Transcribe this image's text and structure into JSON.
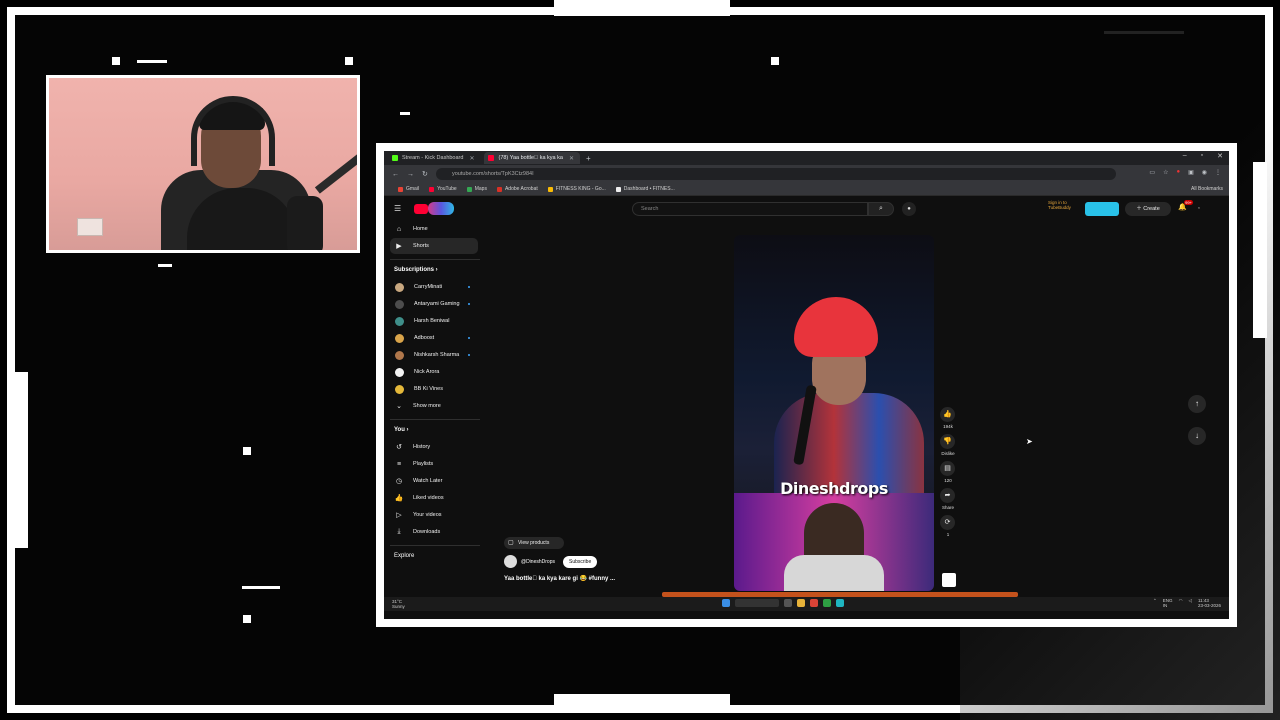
{
  "browser": {
    "tabs": [
      {
        "label": "Stream - Kick Dashboard",
        "favicon_color": "#53fc18",
        "active": false
      },
      {
        "label": "(78) Yaa bottle\u0000 ka kya ka",
        "favicon_color": "#ff0033",
        "active": true
      }
    ],
    "new_tab": "+",
    "url": "youtube.com/shorts/TpK3Ctz984I",
    "bookmarks": [
      "Gmail",
      "YouTube",
      "Maps",
      "Adobe Acrobat",
      "FITNESS KING - Go...",
      "Dashboard • FITNES..."
    ],
    "all_bookmarks": "All Bookmarks"
  },
  "youtube": {
    "search_placeholder": "Search",
    "sign_in": "Sign in to TubeBuddy",
    "create": "Create",
    "notifications_count": "99+",
    "nav": [
      {
        "label": "Home",
        "icon": "home-icon"
      },
      {
        "label": "Shorts",
        "icon": "shorts-icon"
      }
    ],
    "subscriptions_header": "Subscriptions",
    "subscriptions": [
      {
        "label": "CarryMinati",
        "avatar_color": "#c9a880",
        "dot": true
      },
      {
        "label": "Antaryami Gaming",
        "avatar_color": "#4d4d4d",
        "dot": true
      },
      {
        "label": "Harsh Beniwal",
        "avatar_color": "#3f8f8a",
        "dot": false
      },
      {
        "label": "Adboost",
        "avatar_color": "#d9a44a",
        "dot": true
      },
      {
        "label": "Nishkarsh Sharma",
        "avatar_color": "#b0774b",
        "dot": true
      },
      {
        "label": "Nick Arora",
        "avatar_color": "#f3f3f3",
        "dot": false
      },
      {
        "label": "BB Ki Vines",
        "avatar_color": "#e4b83a",
        "dot": false
      }
    ],
    "show_more": "Show more",
    "you_header": "You",
    "you_items": [
      {
        "label": "History",
        "icon": "history-icon"
      },
      {
        "label": "Playlists",
        "icon": "playlists-icon"
      },
      {
        "label": "Watch Later",
        "icon": "clock-icon"
      },
      {
        "label": "Liked videos",
        "icon": "thumbs-up-icon"
      },
      {
        "label": "Your videos",
        "icon": "video-icon"
      },
      {
        "label": "Downloads",
        "icon": "download-icon"
      }
    ],
    "explore_header": "Explore",
    "video": {
      "title_overlay": "Dineshdrops",
      "view_products": "View products",
      "channel": "@DineshDrops",
      "subscribe": "Subscribe",
      "caption": "Yaa bottle\u0000 ka kya kare gi  😂 #funny ..."
    },
    "actions": [
      {
        "icon": "thumbs-up-icon",
        "label": "194k"
      },
      {
        "icon": "thumbs-down-icon",
        "label": "Dislike"
      },
      {
        "icon": "comment-icon",
        "label": "120"
      },
      {
        "icon": "share-icon",
        "label": "Share"
      },
      {
        "icon": "remix-icon",
        "label": "1"
      }
    ]
  },
  "taskbar": {
    "weather_temp": "31°C",
    "weather_desc": "Sunny",
    "lang": "ENG",
    "region": "IN",
    "time": "11:43",
    "date": "23-03-2026"
  }
}
